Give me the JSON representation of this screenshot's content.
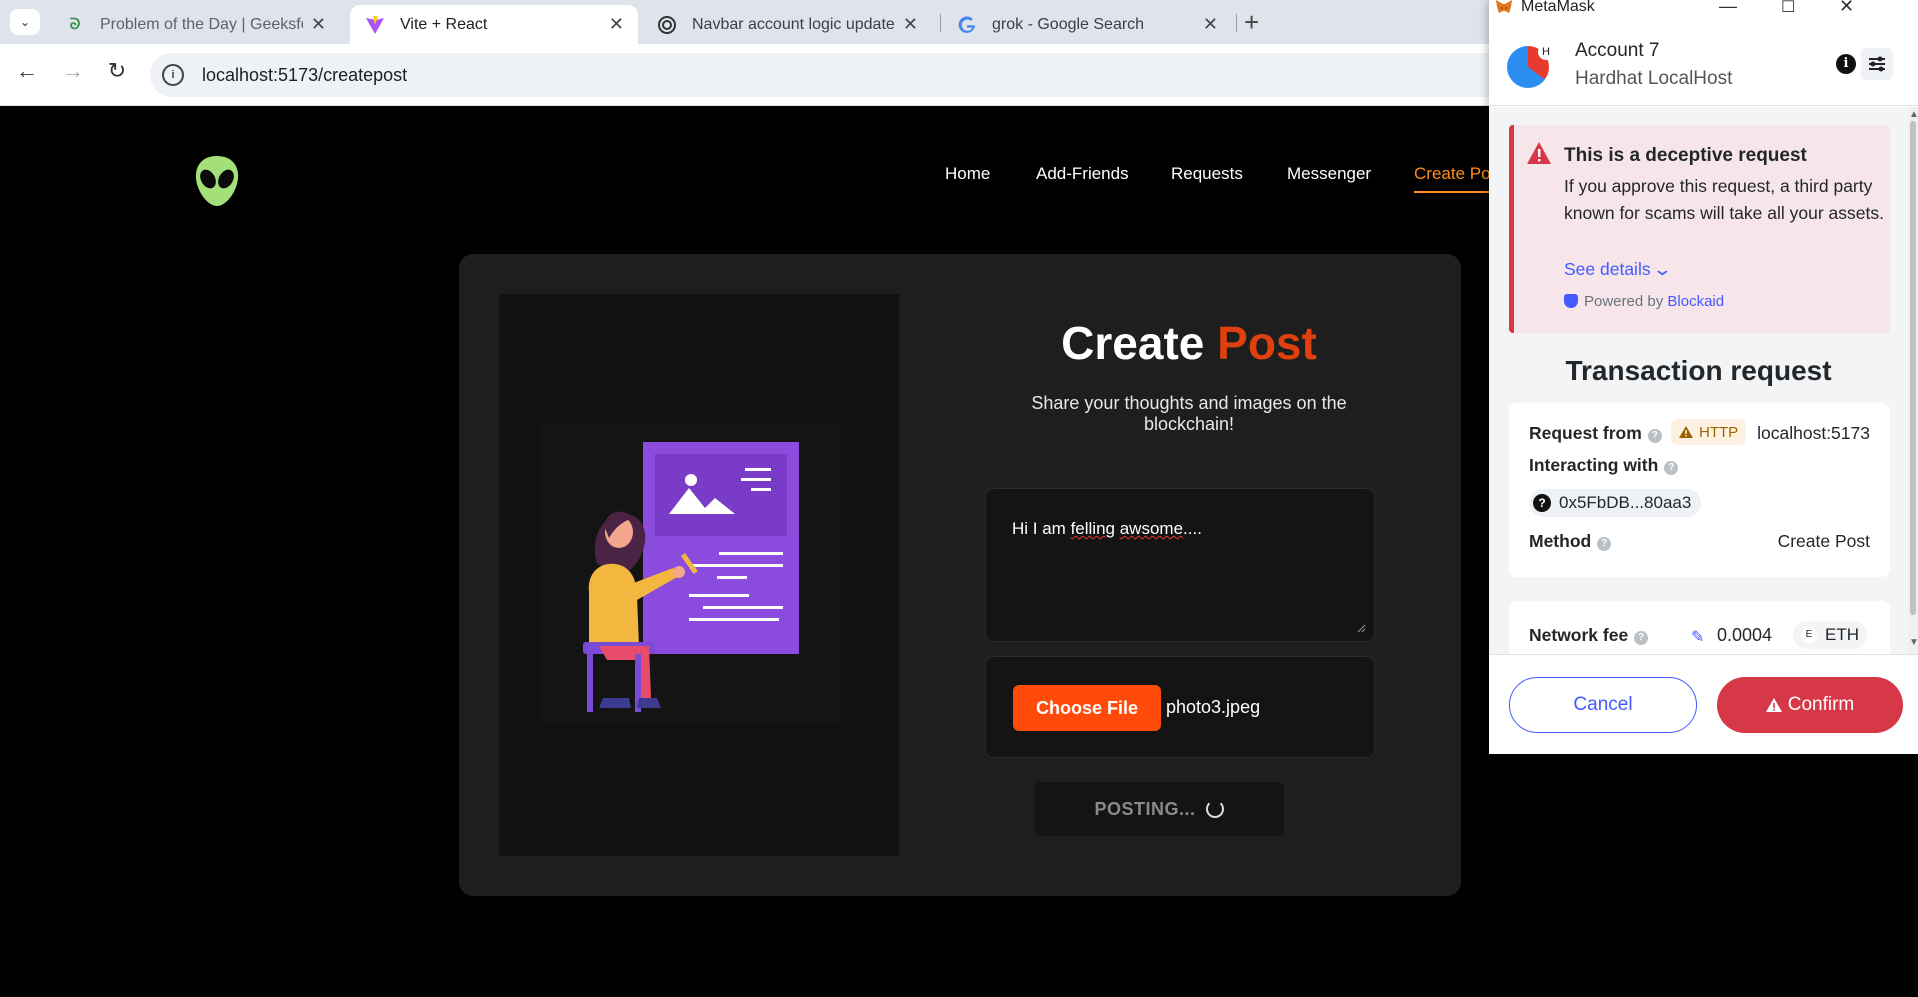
{
  "browser": {
    "tabs": [
      {
        "title": "Problem of the Day | GeeksforG",
        "favicon": "geeksforgeeks-icon",
        "active": false
      },
      {
        "title": "Vite + React",
        "favicon": "vite-icon",
        "active": true
      },
      {
        "title": "Navbar account logic update",
        "favicon": "chatgpt-icon",
        "active": false
      },
      {
        "title": "grok - Google Search",
        "favicon": "google-icon",
        "active": false
      }
    ],
    "new_tab": "+",
    "url": "localhost:5173/createpost"
  },
  "app": {
    "nav": [
      "Home",
      "Add-Friends",
      "Requests",
      "Messenger",
      "Create Post"
    ],
    "active_nav": "Create Post",
    "title_main": "Create",
    "title_accent": "Post",
    "subtitle": "Share your thoughts and images on the blockchain!",
    "post_text": {
      "before": "Hi I am ",
      "misspelled": "felling",
      "middle": " ",
      "misspelled2": "awsome",
      "after": "...."
    },
    "file_button": "Choose File",
    "file_name": "photo3.jpeg",
    "submit_label": "POSTING...",
    "colors": {
      "accent": "#e0400d",
      "button": "#ff4a0a",
      "nav_active": "#ff8c1a"
    }
  },
  "metamask": {
    "window_title": "MetaMask",
    "account": "Account 7",
    "network": "Hardhat LocalHost",
    "avatar_badge": "H",
    "alert": {
      "title": "This is a deceptive request",
      "body": "If you approve this request, a third party known for scams will take all your assets.",
      "link": "See details",
      "powered_prefix": "Powered by",
      "powered_by": "Blockaid"
    },
    "tx_title": "Transaction request",
    "request_from_label": "Request from",
    "protocol": "HTTP",
    "request_from_value": "localhost:5173",
    "interacting_label": "Interacting with",
    "contract": "0x5FbDB...80aa3",
    "method_label": "Method",
    "method_value": "Create Post",
    "fee_label": "Network fee",
    "fee_amount": "0.0004",
    "fee_currency": "ETH",
    "cancel": "Cancel",
    "confirm": "Confirm",
    "colors": {
      "danger": "#d73847",
      "primary": "#4459ff"
    }
  }
}
